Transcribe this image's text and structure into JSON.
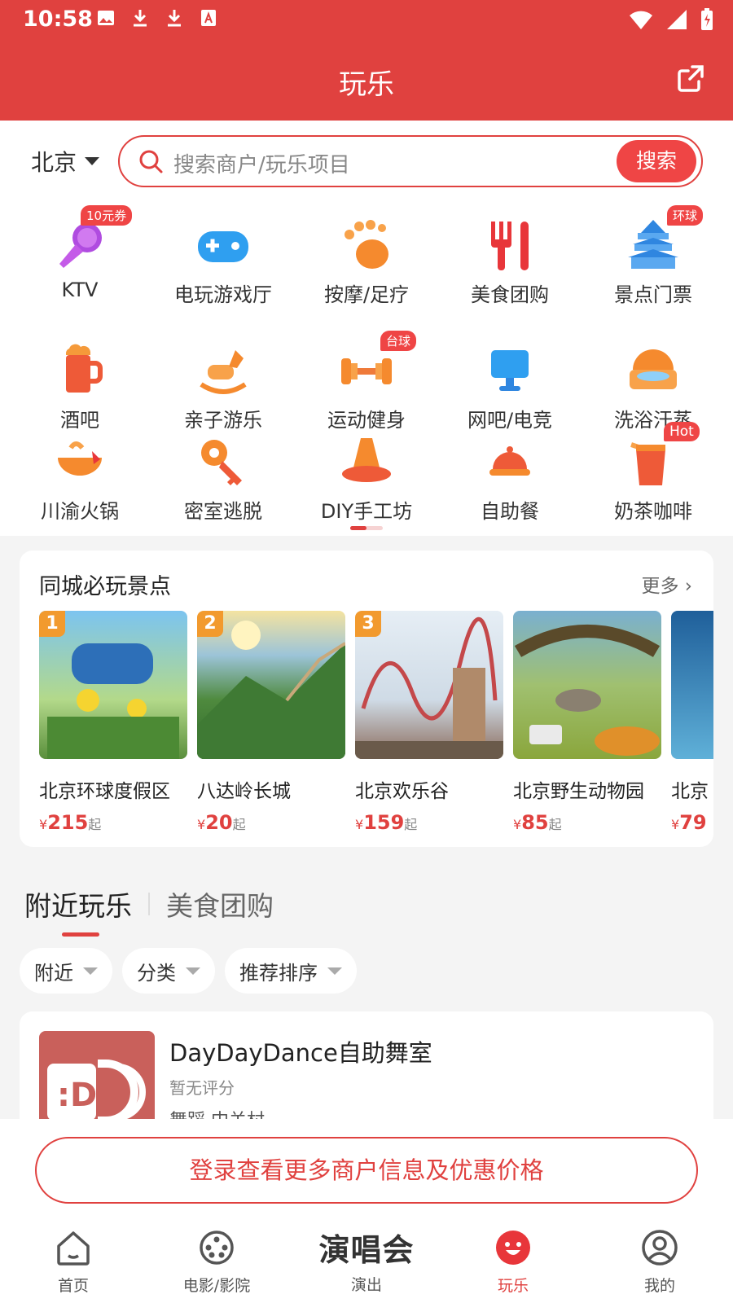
{
  "status_bar": {
    "time": "10:58"
  },
  "app_bar": {
    "title": "玩乐"
  },
  "search": {
    "city": "北京",
    "placeholder": "搜索商户/玩乐项目",
    "button": "搜索"
  },
  "categories": [
    {
      "label": "KTV",
      "badge": "10元券",
      "icon": "microphone-icon"
    },
    {
      "label": "电玩游戏厅",
      "badge": "",
      "icon": "gamepad-icon"
    },
    {
      "label": "按摩/足疗",
      "badge": "",
      "icon": "footprint-icon"
    },
    {
      "label": "美食团购",
      "badge": "",
      "icon": "fork-knife-icon"
    },
    {
      "label": "景点门票",
      "badge": "环球",
      "icon": "temple-icon"
    },
    {
      "label": "酒吧",
      "badge": "",
      "icon": "beer-icon"
    },
    {
      "label": "亲子游乐",
      "badge": "",
      "icon": "rocking-horse-icon"
    },
    {
      "label": "运动健身",
      "badge": "台球",
      "icon": "dumbbell-icon"
    },
    {
      "label": "网吧/电竞",
      "badge": "",
      "icon": "monitor-icon"
    },
    {
      "label": "洗浴汗蒸",
      "badge": "",
      "icon": "bath-icon"
    },
    {
      "label": "川渝火锅",
      "badge": "",
      "icon": "hotpot-icon"
    },
    {
      "label": "密室逃脱",
      "badge": "",
      "icon": "key-icon"
    },
    {
      "label": "DIY手工坊",
      "badge": "",
      "icon": "pottery-icon"
    },
    {
      "label": "自助餐",
      "badge": "",
      "icon": "cloche-icon"
    },
    {
      "label": "奶茶咖啡",
      "badge": "Hot",
      "icon": "milk-tea-icon"
    }
  ],
  "spots": {
    "title": "同城必玩景点",
    "more": "更多",
    "items": [
      {
        "rank": "1",
        "name": "北京环球度假区",
        "currency": "¥",
        "price": "215",
        "suffix": "起",
        "color1": "#4aa3d8",
        "color2": "#8fc96a"
      },
      {
        "rank": "2",
        "name": "八达岭长城",
        "currency": "¥",
        "price": "20",
        "suffix": "起",
        "color1": "#e8c86a",
        "color2": "#3e7d3a"
      },
      {
        "rank": "3",
        "name": "北京欢乐谷",
        "currency": "¥",
        "price": "159",
        "suffix": "起",
        "color1": "#dbe8f3",
        "color2": "#c4484a"
      },
      {
        "rank": "",
        "name": "北京野生动物园",
        "currency": "¥",
        "price": "85",
        "suffix": "起",
        "color1": "#6aa6c8",
        "color2": "#8aa63c"
      },
      {
        "rank": "",
        "name": "北京",
        "currency": "¥",
        "price": "79",
        "suffix": "",
        "color1": "#1f5f9a",
        "color2": "#5fb0d8"
      }
    ]
  },
  "tabs": {
    "active": "附近玩乐",
    "inactive": "美食团购"
  },
  "filters": [
    "附近",
    "分类",
    "推荐排序"
  ],
  "merchant": {
    "name": "DayDayDance自助舞室",
    "rating": "暂无评分",
    "meta": "舞蹈 中关村"
  },
  "login_prompt": "登录查看更多商户信息及优惠价格",
  "tabbar": {
    "items": [
      {
        "label": "首页",
        "icon": "home-icon"
      },
      {
        "label": "电影/影院",
        "icon": "film-reel-icon"
      },
      {
        "label": "演出",
        "big": "演唱会"
      },
      {
        "label": "玩乐",
        "icon": "smile-icon"
      },
      {
        "label": "我的",
        "icon": "user-icon"
      }
    ]
  },
  "colors": {
    "brand": "#e0413f",
    "badge": "#ef4545",
    "rank": "#f29a2e"
  }
}
